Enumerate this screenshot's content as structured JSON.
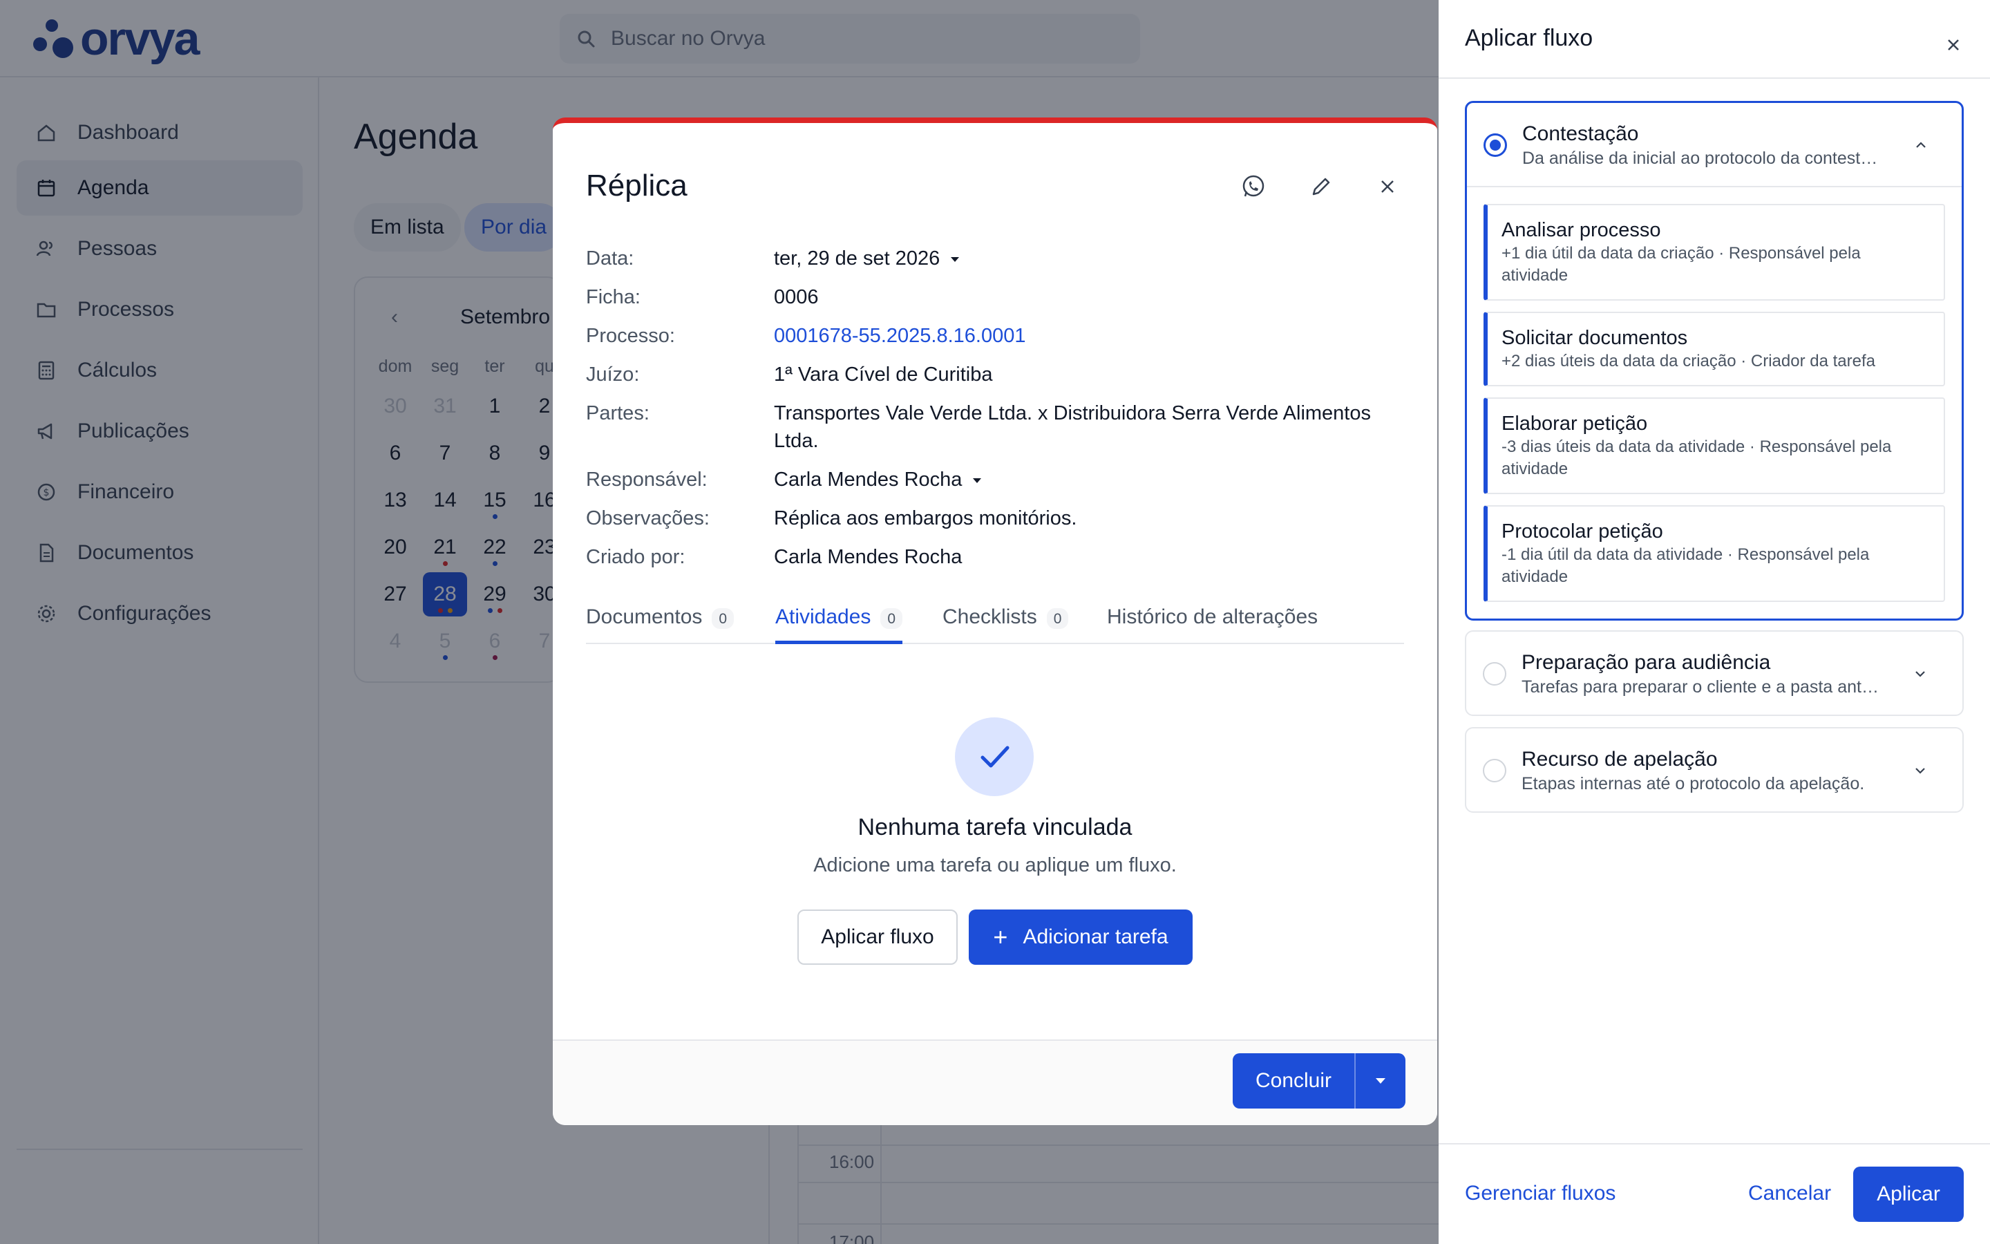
{
  "app": {
    "logo_text": "orvya"
  },
  "search": {
    "placeholder": "Buscar no Orvya"
  },
  "sidebar": {
    "items": [
      {
        "label": "Dashboard",
        "icon": "home-icon",
        "active": false
      },
      {
        "label": "Agenda",
        "icon": "calendar-icon",
        "active": true
      },
      {
        "label": "Pessoas",
        "icon": "people-icon",
        "active": false
      },
      {
        "label": "Processos",
        "icon": "folder-icon",
        "active": false
      },
      {
        "label": "Cálculos",
        "icon": "calculator-icon",
        "active": false
      },
      {
        "label": "Publicações",
        "icon": "megaphone-icon",
        "active": false
      },
      {
        "label": "Financeiro",
        "icon": "dollar-icon",
        "active": false
      },
      {
        "label": "Documentos",
        "icon": "document-icon",
        "active": false
      },
      {
        "label": "Configurações",
        "icon": "gear-icon",
        "active": false
      }
    ]
  },
  "agenda": {
    "title": "Agenda",
    "views": {
      "list": "Em lista",
      "day": "Por dia"
    },
    "calendar": {
      "month": "Setembro",
      "weekdays": [
        "dom",
        "seg",
        "ter",
        "qu"
      ],
      "rows": [
        [
          "30",
          "31",
          "1",
          "2"
        ],
        [
          "6",
          "7",
          "8",
          "9"
        ],
        [
          "13",
          "14",
          "15",
          "16"
        ],
        [
          "20",
          "21",
          "22",
          "23"
        ],
        [
          "27",
          "28",
          "29",
          "30"
        ],
        [
          "4",
          "5",
          "6",
          "7"
        ]
      ],
      "selected_day": "28"
    },
    "timeline": {
      "times": [
        "16:00",
        "17:00"
      ]
    }
  },
  "modal": {
    "title": "Réplica",
    "fields": {
      "data_label": "Data:",
      "data_value": "ter, 29 de set 2026",
      "ficha_label": "Ficha:",
      "ficha_value": "0006",
      "processo_label": "Processo:",
      "processo_value": "0001678-55.2025.8.16.0001",
      "juizo_label": "Juízo:",
      "juizo_value": "1ª Vara Cível de Curitiba",
      "partes_label": "Partes:",
      "partes_value": "Transportes Vale Verde Ltda. x Distribuidora Serra Verde Alimentos Ltda.",
      "responsavel_label": "Responsável:",
      "responsavel_value": "Carla Mendes Rocha",
      "observacoes_label": "Observações:",
      "observacoes_value": "Réplica aos embargos monitórios.",
      "criado_label": "Criado por:",
      "criado_value": "Carla Mendes Rocha"
    },
    "tabs": {
      "documentos": "Documentos",
      "documentos_count": "0",
      "atividades": "Atividades",
      "atividades_count": "0",
      "checklists": "Checklists",
      "checklists_count": "0",
      "historico": "Histórico de alterações"
    },
    "empty": {
      "title": "Nenhuma tarefa vinculada",
      "subtitle": "Adicione uma tarefa ou aplique um fluxo.",
      "apply_flow": "Aplicar fluxo",
      "add_task": "Adicionar tarefa"
    },
    "footer": {
      "concluir": "Concluir"
    },
    "accent_color": "#dc2626"
  },
  "drawer": {
    "title": "Aplicar fluxo",
    "flows": [
      {
        "name": "Contestação",
        "description": "Da análise da inicial ao protocolo da contestação.",
        "selected": true,
        "expanded": true,
        "steps": [
          {
            "title": "Analisar processo",
            "detail": "+1 dia útil da data da criação · Responsável pela atividade"
          },
          {
            "title": "Solicitar documentos",
            "detail": "+2 dias úteis da data da criação · Criador da tarefa"
          },
          {
            "title": "Elaborar petição",
            "detail": "-3 dias úteis da data da atividade · Responsável pela atividade"
          },
          {
            "title": "Protocolar petição",
            "detail": "-1 dia útil da data da atividade · Responsável pela atividade"
          }
        ]
      },
      {
        "name": "Preparação para audiência",
        "description": "Tarefas para preparar o cliente e a pasta antes da audiência.",
        "selected": false,
        "expanded": false
      },
      {
        "name": "Recurso de apelação",
        "description": "Etapas internas até o protocolo da apelação.",
        "selected": false,
        "expanded": false
      }
    ],
    "footer": {
      "manage": "Gerenciar fluxos",
      "cancel": "Cancelar",
      "apply": "Aplicar"
    }
  },
  "colors": {
    "primary": "#1d4ed8",
    "brand": "#1d3b8f"
  }
}
